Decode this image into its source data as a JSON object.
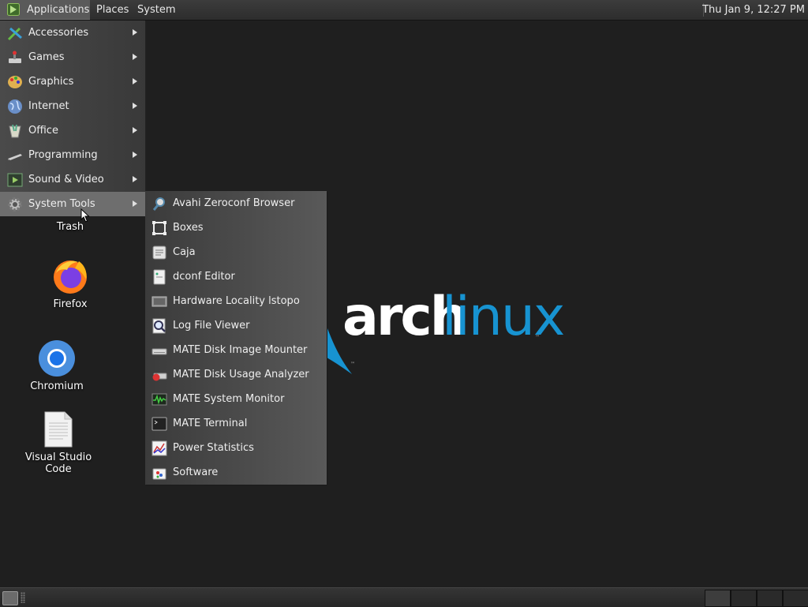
{
  "top_panel": {
    "applications_label": "Applications",
    "places_label": "Places",
    "system_label": "System",
    "clock": "Thu Jan  9, 12:27 PM"
  },
  "desktop": {
    "logo": {
      "part1": "arch",
      "part2": "linux",
      "tm": "™"
    },
    "icons": [
      {
        "label": "Trash",
        "icon": "trash-icon"
      },
      {
        "label": "Firefox",
        "icon": "firefox-icon"
      },
      {
        "label": "Chromium",
        "icon": "chromium-icon"
      },
      {
        "label": "Visual Studio Code",
        "icon": "document-icon"
      }
    ]
  },
  "applications_menu": {
    "items": [
      {
        "label": "Accessories",
        "icon": "accessories-icon"
      },
      {
        "label": "Games",
        "icon": "games-icon"
      },
      {
        "label": "Graphics",
        "icon": "graphics-icon"
      },
      {
        "label": "Internet",
        "icon": "internet-globe-icon"
      },
      {
        "label": "Office",
        "icon": "office-icon"
      },
      {
        "label": "Programming",
        "icon": "programming-icon"
      },
      {
        "label": "Sound & Video",
        "icon": "sound-video-icon"
      },
      {
        "label": "System Tools",
        "icon": "system-tools-gear-icon"
      }
    ],
    "active_item": "System Tools"
  },
  "system_tools_submenu": {
    "items": [
      {
        "label": "Avahi Zeroconf Browser",
        "icon": "avahi-icon"
      },
      {
        "label": "Boxes",
        "icon": "boxes-icon"
      },
      {
        "label": "Caja",
        "icon": "caja-file-manager-icon"
      },
      {
        "label": "dconf Editor",
        "icon": "dconf-editor-icon"
      },
      {
        "label": "Hardware Locality lstopo",
        "icon": "hardware-icon"
      },
      {
        "label": "Log File Viewer",
        "icon": "log-viewer-icon"
      },
      {
        "label": "MATE Disk Image Mounter",
        "icon": "disk-mounter-icon"
      },
      {
        "label": "MATE Disk Usage Analyzer",
        "icon": "disk-usage-icon"
      },
      {
        "label": "MATE System Monitor",
        "icon": "system-monitor-icon"
      },
      {
        "label": "MATE Terminal",
        "icon": "terminal-icon"
      },
      {
        "label": "Power Statistics",
        "icon": "power-statistics-icon"
      },
      {
        "label": "Software",
        "icon": "software-icon"
      }
    ]
  },
  "colors": {
    "arch_blue": "#1793d1",
    "desktop_bg": "#1f1f1f",
    "menu_highlight": "#6e6e6e"
  }
}
